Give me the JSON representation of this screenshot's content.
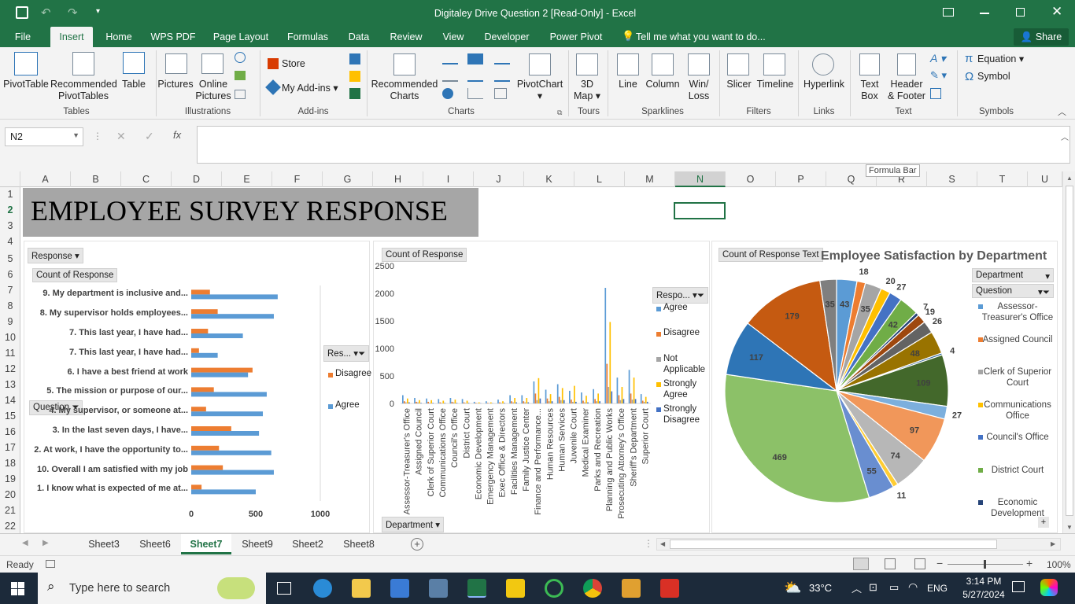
{
  "window": {
    "title": "Digitaley Drive Question 2  [Read-Only] - Excel",
    "share": "Share"
  },
  "tabs": [
    "File",
    "Insert",
    "Home",
    "WPS PDF",
    "Page Layout",
    "Formulas",
    "Data",
    "Review",
    "View",
    "Developer",
    "Power Pivot"
  ],
  "tellme": "Tell me what you want to do...",
  "ribbon": {
    "buttons": {
      "pivottable": "PivotTable",
      "recommended_pivot": "Recommended",
      "recommended_pivot2": "PivotTables",
      "table": "Table",
      "pictures": "Pictures",
      "online": "Online",
      "online2": "Pictures",
      "store": "Store",
      "myaddins": "My Add-ins",
      "reccharts": "Recommended",
      "reccharts2": "Charts",
      "pivotchart": "PivotChart",
      "map3d": "3D",
      "map3d2": "Map",
      "line": "Line",
      "column": "Column",
      "winloss": "Win/",
      "winloss2": "Loss",
      "slicer": "Slicer",
      "timeline": "Timeline",
      "hyperlink": "Hyperlink",
      "textbox": "Text",
      "textbox2": "Box",
      "header": "Header",
      "header2": "& Footer",
      "equation": "Equation",
      "symbol": "Symbol"
    },
    "groups": [
      "Tables",
      "Illustrations",
      "Add-ins",
      "Charts",
      "Tours",
      "Sparklines",
      "Filters",
      "Links",
      "Text",
      "Symbols"
    ]
  },
  "formula_bar": {
    "namebox": "N2",
    "fx": "fx",
    "tooltip": "Formula Bar"
  },
  "columns": [
    "A",
    "B",
    "C",
    "D",
    "E",
    "F",
    "G",
    "H",
    "I",
    "J",
    "K",
    "L",
    "M",
    "N",
    "O",
    "P",
    "Q",
    "R",
    "S",
    "T",
    "U"
  ],
  "rows": [
    "1",
    "2",
    "3",
    "4",
    "5",
    "6",
    "7",
    "8",
    "9",
    "10",
    "11",
    "12",
    "13",
    "14",
    "15",
    "16",
    "17",
    "18",
    "19",
    "20",
    "21",
    "22"
  ],
  "sheet_title": "EMPLOYEE SURVEY RESPONSE",
  "pivot1": {
    "response_btn": "Response",
    "count_label": "Count of Response",
    "question_btn": "Question",
    "legend_btn": "Res...",
    "legend": [
      "Disagree",
      "Agree"
    ],
    "colors": {
      "Disagree": "#ed7d31",
      "Agree": "#5b9bd5"
    }
  },
  "pivot2": {
    "count_label": "Count of Response",
    "dept_btn": "Department",
    "legend_btn": "Respo...",
    "legend": [
      "Agree",
      "Disagree",
      "Not Applicable",
      "Strongly Agree",
      "Strongly Disagree"
    ]
  },
  "pivot3": {
    "count_label": "Count of Response Text",
    "title": "Employee Satisfaction by Department",
    "dept_btn": "Department",
    "question_btn": "Question",
    "legend": [
      "Assessor-Treasurer's Office",
      "Assigned Council",
      "Clerk of Superior Court",
      "Communications Office",
      "Council's Office",
      "District Court",
      "Economic Development"
    ]
  },
  "chart_data": [
    {
      "type": "bar",
      "categories": [
        "9. My department is inclusive and...",
        "8. My supervisor holds employees...",
        "7. This last year, I have had...",
        "7. This last year, I have had...",
        "6. I have a best friend at work",
        "5. The mission or purpose of our...",
        "4. My supervisor, or someone at...",
        "3. In the last seven days, I have...",
        "2. At work, I have the opportunity to...",
        "10. Overall I am satisfied with my job",
        "1. I know what is expected of me at..."
      ],
      "series": [
        {
          "name": "Disagree",
          "values": [
            145,
            205,
            130,
            60,
            475,
            175,
            115,
            310,
            215,
            245,
            80
          ]
        },
        {
          "name": "Agree",
          "values": [
            670,
            640,
            400,
            205,
            440,
            585,
            555,
            525,
            620,
            640,
            500
          ]
        }
      ],
      "xlim": [
        0,
        1000
      ],
      "xticks": [
        "0",
        "500",
        "1000"
      ]
    },
    {
      "type": "bar",
      "categories": [
        "Assessor-Treasurer's Office",
        "Assigned Council",
        "Clerk of Superior Court",
        "Communications Office",
        "Council's Office",
        "District Court",
        "Economic Development",
        "Emergency Management",
        "Exec Office & Directors",
        "Facilities Management",
        "Family Justice Center",
        "Finance and Performance...",
        "Human Resources",
        "Human Services",
        "Juvenile Court",
        "Medical Examiner",
        "Parks and Recreation",
        "Planning and Public Works",
        "Prosecuting Attorney's Office",
        "Sheriff's Department",
        "Superior Court"
      ],
      "series": [
        {
          "name": "Agree",
          "values": [
            150,
            100,
            90,
            80,
            100,
            80,
            30,
            40,
            70,
            150,
            150,
            400,
            250,
            350,
            230,
            200,
            260,
            2100,
            470,
            610,
            170
          ]
        },
        {
          "name": "Disagree",
          "values": [
            40,
            30,
            30,
            20,
            30,
            20,
            10,
            10,
            20,
            40,
            40,
            180,
            90,
            120,
            70,
            50,
            80,
            720,
            150,
            180,
            50
          ]
        },
        {
          "name": "Not Applicable",
          "values": [
            20,
            20,
            10,
            10,
            20,
            10,
            5,
            5,
            10,
            20,
            20,
            60,
            40,
            60,
            30,
            20,
            40,
            300,
            60,
            70,
            30
          ]
        },
        {
          "name": "Strongly Agree",
          "values": [
            90,
            60,
            60,
            50,
            70,
            50,
            20,
            20,
            40,
            100,
            100,
            460,
            170,
            280,
            320,
            140,
            180,
            1480,
            300,
            470,
            120
          ]
        },
        {
          "name": "Strongly Disagree",
          "values": [
            20,
            10,
            10,
            10,
            10,
            10,
            5,
            5,
            10,
            20,
            20,
            90,
            40,
            60,
            30,
            20,
            40,
            220,
            80,
            80,
            30
          ]
        }
      ],
      "colors": [
        "#5b9bd5",
        "#ed7d31",
        "#a5a5a5",
        "#ffc000",
        "#4472c4"
      ],
      "ylim": [
        0,
        2500
      ],
      "yticks": [
        "0",
        "500",
        "1000",
        "1500",
        "2000",
        "2500"
      ]
    },
    {
      "type": "pie",
      "title": "Employee Satisfaction by Department",
      "values": [
        43,
        18,
        35,
        20,
        27,
        42,
        7,
        19,
        26,
        48,
        4,
        109,
        27,
        97,
        74,
        11,
        55,
        469,
        117,
        179,
        35
      ],
      "labels": [
        "43",
        "18",
        "35",
        "20",
        "27",
        "42",
        "7",
        "19",
        "26",
        "48",
        "4",
        "109",
        "27",
        "97",
        "74",
        "11",
        "55",
        "469",
        "117",
        "179",
        "35"
      ],
      "colors": [
        "#5b9bd5",
        "#ed7d31",
        "#a5a5a5",
        "#ffc000",
        "#4472c4",
        "#70ad47",
        "#264478",
        "#9e480e",
        "#636363",
        "#997300",
        "#255e91",
        "#43682b",
        "#7cafdd",
        "#f1975a",
        "#b7b7b7",
        "#ffcd33",
        "#698ed0",
        "#8cc168",
        "#2e75b6",
        "#c55a11",
        "#7f7f7f"
      ]
    }
  ],
  "sheets": [
    "Sheet3",
    "Sheet6",
    "Sheet7",
    "Sheet9",
    "Sheet2",
    "Sheet8"
  ],
  "active_sheet": "Sheet7",
  "status": {
    "ready": "Ready",
    "zoom": "100%"
  },
  "taskbar": {
    "search": "Type here to search",
    "temp": "33°C",
    "lang": "ENG",
    "time": "3:14 PM",
    "date": "5/27/2024"
  }
}
